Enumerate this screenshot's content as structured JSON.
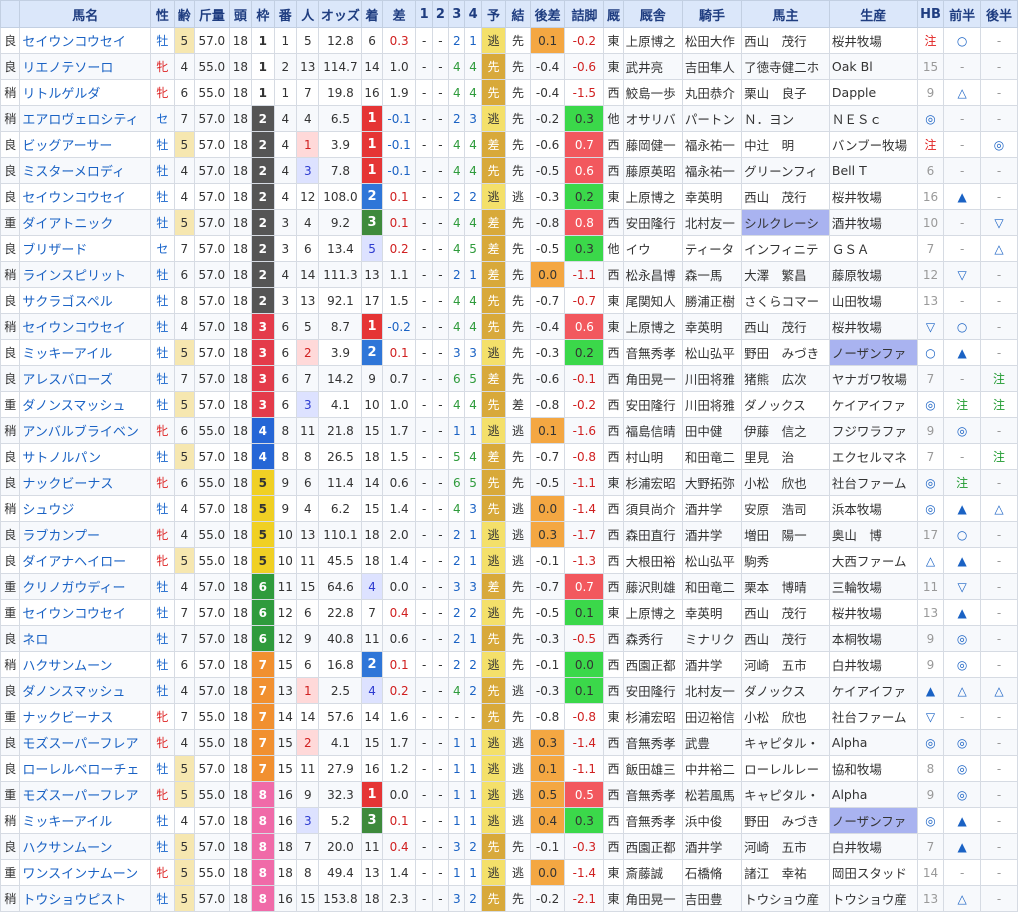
{
  "headers": [
    "馬名",
    "性",
    "齢",
    "斤量",
    "頭",
    "枠",
    "番",
    "人",
    "オッズ",
    "着",
    "差",
    "1",
    "2",
    "3",
    "4",
    "予",
    "結",
    "後差",
    "詰脚",
    "厩",
    "厩舎",
    "騎手",
    "馬主",
    "生産",
    "HB",
    "前半",
    "後半"
  ],
  "rows": [
    {
      "baba": "良",
      "name": "セイウンコウセイ",
      "sex": "牡",
      "age": "5",
      "kin": "57.0",
      "to": "18",
      "waku": "1",
      "ban": "1",
      "pop": "5",
      "odds": "12.8",
      "chaku": "6",
      "sa": "0.3",
      "c1": "-",
      "c2": "-",
      "c3": "2",
      "c4": "1",
      "yo": "逃",
      "ke": "先",
      "go": "0.1",
      "ts": "-0.2",
      "ki": "東",
      "kyu": "上原博之",
      "jk": "松田大作",
      "ow": "西山　茂行",
      "pr": "桜井牧場",
      "hb": "注",
      "mae": "○",
      "ato": "-"
    },
    {
      "baba": "良",
      "name": "リエノテソーロ",
      "sex": "牝",
      "age": "4",
      "kin": "55.0",
      "to": "18",
      "waku": "1",
      "ban": "2",
      "pop": "13",
      "odds": "114.7",
      "chaku": "14",
      "sa": "1.0",
      "c1": "-",
      "c2": "-",
      "c3": "4",
      "c4": "4",
      "yo": "先",
      "ke": "先",
      "go": "-0.4",
      "ts": "-0.6",
      "ki": "東",
      "kyu": "武井亮",
      "jk": "吉田隼人",
      "ow": "了徳寺健二ホ",
      "pr": "Oak Bl",
      "hb": "15",
      "mae": "-",
      "ato": "-"
    },
    {
      "baba": "稍",
      "name": "リトルゲルダ",
      "sex": "牝",
      "age": "6",
      "kin": "55.0",
      "to": "18",
      "waku": "1",
      "ban": "1",
      "pop": "7",
      "odds": "19.8",
      "chaku": "16",
      "sa": "1.9",
      "c1": "-",
      "c2": "-",
      "c3": "4",
      "c4": "4",
      "yo": "先",
      "ke": "先",
      "go": "-0.4",
      "ts": "-1.5",
      "ki": "西",
      "kyu": "鮫島一歩",
      "jk": "丸田恭介",
      "ow": "栗山　良子",
      "pr": "Dapple",
      "hb": "9",
      "mae": "△",
      "ato": "-"
    },
    {
      "baba": "稍",
      "name": "エアロヴェロシティ",
      "sex": "セ",
      "age": "7",
      "kin": "57.0",
      "to": "18",
      "waku": "2",
      "ban": "4",
      "pop": "4",
      "odds": "6.5",
      "chaku": "1",
      "sa": "-0.1",
      "c1": "-",
      "c2": "-",
      "c3": "2",
      "c4": "3",
      "yo": "逃",
      "ke": "先",
      "go": "-0.2",
      "ts": "0.3",
      "ki": "他",
      "kyu": "オサリバ",
      "jk": "パートン",
      "ow": "Ｎ．ヨン",
      "pr": "ＮＥＳｃ",
      "hb": "◎",
      "mae": "-",
      "ato": "-"
    },
    {
      "baba": "良",
      "name": "ビッグアーサー",
      "sex": "牡",
      "age": "5",
      "kin": "57.0",
      "to": "18",
      "waku": "2",
      "ban": "4",
      "pop": "1",
      "odds": "3.9",
      "chaku": "1",
      "sa": "-0.1",
      "c1": "-",
      "c2": "-",
      "c3": "4",
      "c4": "4",
      "yo": "差",
      "ke": "先",
      "go": "-0.6",
      "ts": "0.7",
      "ki": "西",
      "kyu": "藤岡健一",
      "jk": "福永祐一",
      "ow": "中辻　明",
      "pr": "バンブー牧場",
      "hb": "注",
      "mae": "-",
      "ato": "◎"
    },
    {
      "baba": "良",
      "name": "ミスターメロディ",
      "sex": "牡",
      "age": "4",
      "kin": "57.0",
      "to": "18",
      "waku": "2",
      "ban": "4",
      "pop": "3",
      "odds": "7.8",
      "chaku": "1",
      "sa": "-0.1",
      "c1": "-",
      "c2": "-",
      "c3": "4",
      "c4": "4",
      "yo": "先",
      "ke": "先",
      "go": "-0.5",
      "ts": "0.6",
      "ki": "西",
      "kyu": "藤原英昭",
      "jk": "福永祐一",
      "ow": "グリーンフィ",
      "pr": "Bell T",
      "hb": "6",
      "mae": "-",
      "ato": "-"
    },
    {
      "baba": "良",
      "name": "セイウンコウセイ",
      "sex": "牡",
      "age": "4",
      "kin": "57.0",
      "to": "18",
      "waku": "2",
      "ban": "4",
      "pop": "12",
      "odds": "108.0",
      "chaku": "2",
      "sa": "0.1",
      "c1": "-",
      "c2": "-",
      "c3": "2",
      "c4": "2",
      "yo": "逃",
      "ke": "逃",
      "go": "-0.3",
      "ts": "0.2",
      "ki": "東",
      "kyu": "上原博之",
      "jk": "幸英明",
      "ow": "西山　茂行",
      "pr": "桜井牧場",
      "hb": "16",
      "mae": "▲",
      "ato": "-"
    },
    {
      "baba": "重",
      "name": "ダイアトニック",
      "sex": "牡",
      "age": "5",
      "kin": "57.0",
      "to": "18",
      "waku": "2",
      "ban": "3",
      "pop": "4",
      "odds": "9.2",
      "chaku": "3",
      "sa": "0.1",
      "c1": "-",
      "c2": "-",
      "c3": "4",
      "c4": "4",
      "yo": "差",
      "ke": "先",
      "go": "-0.8",
      "ts": "0.8",
      "ki": "西",
      "kyu": "安田隆行",
      "jk": "北村友一",
      "ow": "シルクレーシ",
      "pr": "酒井牧場",
      "hb": "10",
      "mae": "-",
      "ato": "▽"
    },
    {
      "baba": "良",
      "name": "ブリザード",
      "sex": "セ",
      "age": "7",
      "kin": "57.0",
      "to": "18",
      "waku": "2",
      "ban": "3",
      "pop": "6",
      "odds": "13.4",
      "chaku": "5",
      "sa": "0.2",
      "c1": "-",
      "c2": "-",
      "c3": "4",
      "c4": "5",
      "yo": "差",
      "ke": "先",
      "go": "-0.5",
      "ts": "0.3",
      "ki": "他",
      "kyu": "イウ",
      "jk": "ティータ",
      "ow": "インフィニテ",
      "pr": "ＧＳＡ",
      "hb": "7",
      "mae": "-",
      "ato": "△"
    },
    {
      "baba": "稍",
      "name": "ラインスピリット",
      "sex": "牡",
      "age": "6",
      "kin": "57.0",
      "to": "18",
      "waku": "2",
      "ban": "4",
      "pop": "14",
      "odds": "111.3",
      "chaku": "13",
      "sa": "1.1",
      "c1": "-",
      "c2": "-",
      "c3": "2",
      "c4": "1",
      "yo": "差",
      "ke": "先",
      "go": "0.0",
      "ts": "-1.1",
      "ki": "西",
      "kyu": "松永昌博",
      "jk": "森一馬",
      "ow": "大澤　繁昌",
      "pr": "藤原牧場",
      "hb": "12",
      "mae": "▽",
      "ato": "-"
    },
    {
      "baba": "良",
      "name": "サクラゴスペル",
      "sex": "牡",
      "age": "8",
      "kin": "57.0",
      "to": "18",
      "waku": "2",
      "ban": "3",
      "pop": "13",
      "odds": "92.1",
      "chaku": "17",
      "sa": "1.5",
      "c1": "-",
      "c2": "-",
      "c3": "4",
      "c4": "4",
      "yo": "先",
      "ke": "先",
      "go": "-0.7",
      "ts": "-0.7",
      "ki": "東",
      "kyu": "尾関知人",
      "jk": "勝浦正樹",
      "ow": "さくらコマー",
      "pr": "山田牧場",
      "hb": "13",
      "mae": "-",
      "ato": "-"
    },
    {
      "baba": "稍",
      "name": "セイウンコウセイ",
      "sex": "牡",
      "age": "4",
      "kin": "57.0",
      "to": "18",
      "waku": "3",
      "ban": "6",
      "pop": "5",
      "odds": "8.7",
      "chaku": "1",
      "sa": "-0.2",
      "c1": "-",
      "c2": "-",
      "c3": "4",
      "c4": "4",
      "yo": "先",
      "ke": "先",
      "go": "-0.4",
      "ts": "0.6",
      "ki": "東",
      "kyu": "上原博之",
      "jk": "幸英明",
      "ow": "西山　茂行",
      "pr": "桜井牧場",
      "hb": "▽",
      "mae": "○",
      "ato": "-"
    },
    {
      "baba": "良",
      "name": "ミッキーアイル",
      "sex": "牡",
      "age": "5",
      "kin": "57.0",
      "to": "18",
      "waku": "3",
      "ban": "6",
      "pop": "2",
      "odds": "3.9",
      "chaku": "2",
      "sa": "0.1",
      "c1": "-",
      "c2": "-",
      "c3": "3",
      "c4": "3",
      "yo": "逃",
      "ke": "先",
      "go": "-0.3",
      "ts": "0.2",
      "ki": "西",
      "kyu": "音無秀孝",
      "jk": "松山弘平",
      "ow": "野田　みづき",
      "pr": "ノーザンファ",
      "hb": "○",
      "mae": "▲",
      "ato": "-"
    },
    {
      "baba": "良",
      "name": "アレスバローズ",
      "sex": "牡",
      "age": "7",
      "kin": "57.0",
      "to": "18",
      "waku": "3",
      "ban": "6",
      "pop": "7",
      "odds": "14.2",
      "chaku": "9",
      "sa": "0.7",
      "c1": "-",
      "c2": "-",
      "c3": "6",
      "c4": "5",
      "yo": "差",
      "ke": "先",
      "go": "-0.6",
      "ts": "-0.1",
      "ki": "西",
      "kyu": "角田晃一",
      "jk": "川田将雅",
      "ow": "猪熊　広次",
      "pr": "ヤナガワ牧場",
      "hb": "7",
      "mae": "-",
      "ato": "注"
    },
    {
      "baba": "重",
      "name": "ダノンスマッシュ",
      "sex": "牡",
      "age": "5",
      "kin": "57.0",
      "to": "18",
      "waku": "3",
      "ban": "6",
      "pop": "3",
      "odds": "4.1",
      "chaku": "10",
      "sa": "1.0",
      "c1": "-",
      "c2": "-",
      "c3": "4",
      "c4": "4",
      "yo": "先",
      "ke": "差",
      "go": "-0.8",
      "ts": "-0.2",
      "ki": "西",
      "kyu": "安田隆行",
      "jk": "川田将雅",
      "ow": "ダノックス",
      "pr": "ケイアイファ",
      "hb": "◎",
      "mae": "注",
      "ato": "注"
    },
    {
      "baba": "稍",
      "name": "アンバルブライベン",
      "sex": "牝",
      "age": "6",
      "kin": "55.0",
      "to": "18",
      "waku": "4",
      "ban": "8",
      "pop": "11",
      "odds": "21.8",
      "chaku": "15",
      "sa": "1.7",
      "c1": "-",
      "c2": "-",
      "c3": "1",
      "c4": "1",
      "yo": "逃",
      "ke": "逃",
      "go": "0.1",
      "ts": "-1.6",
      "ki": "西",
      "kyu": "福島信晴",
      "jk": "田中健",
      "ow": "伊藤　信之",
      "pr": "フジワラファ",
      "hb": "9",
      "mae": "◎",
      "ato": "-"
    },
    {
      "baba": "良",
      "name": "サトノルパン",
      "sex": "牡",
      "age": "5",
      "kin": "57.0",
      "to": "18",
      "waku": "4",
      "ban": "8",
      "pop": "8",
      "odds": "26.5",
      "chaku": "18",
      "sa": "1.5",
      "c1": "-",
      "c2": "-",
      "c3": "5",
      "c4": "4",
      "yo": "差",
      "ke": "先",
      "go": "-0.7",
      "ts": "-0.8",
      "ki": "西",
      "kyu": "村山明",
      "jk": "和田竜二",
      "ow": "里見　治",
      "pr": "エクセルマネ",
      "hb": "7",
      "mae": "-",
      "ato": "注"
    },
    {
      "baba": "良",
      "name": "ナックビーナス",
      "sex": "牝",
      "age": "6",
      "kin": "55.0",
      "to": "18",
      "waku": "5",
      "ban": "9",
      "pop": "6",
      "odds": "11.4",
      "chaku": "14",
      "sa": "0.6",
      "c1": "-",
      "c2": "-",
      "c3": "6",
      "c4": "5",
      "yo": "先",
      "ke": "先",
      "go": "-0.5",
      "ts": "-1.1",
      "ki": "東",
      "kyu": "杉浦宏昭",
      "jk": "大野拓弥",
      "ow": "小松　欣也",
      "pr": "社台ファーム",
      "hb": "◎",
      "mae": "注",
      "ato": "-"
    },
    {
      "baba": "稍",
      "name": "シュウジ",
      "sex": "牡",
      "age": "4",
      "kin": "57.0",
      "to": "18",
      "waku": "5",
      "ban": "9",
      "pop": "4",
      "odds": "6.2",
      "chaku": "15",
      "sa": "1.4",
      "c1": "-",
      "c2": "-",
      "c3": "4",
      "c4": "3",
      "yo": "先",
      "ke": "逃",
      "go": "0.0",
      "ts": "-1.4",
      "ki": "西",
      "kyu": "須貝尚介",
      "jk": "酒井学",
      "ow": "安原　浩司",
      "pr": "浜本牧場",
      "hb": "◎",
      "mae": "▲",
      "ato": "△"
    },
    {
      "baba": "良",
      "name": "ラブカンプー",
      "sex": "牝",
      "age": "4",
      "kin": "55.0",
      "to": "18",
      "waku": "5",
      "ban": "10",
      "pop": "13",
      "odds": "110.1",
      "chaku": "18",
      "sa": "2.0",
      "c1": "-",
      "c2": "-",
      "c3": "2",
      "c4": "1",
      "yo": "逃",
      "ke": "逃",
      "go": "0.3",
      "ts": "-1.7",
      "ki": "西",
      "kyu": "森田直行",
      "jk": "酒井学",
      "ow": "増田　陽一",
      "pr": "奥山　博",
      "hb": "17",
      "mae": "○",
      "ato": "-"
    },
    {
      "baba": "良",
      "name": "ダイアナヘイロー",
      "sex": "牝",
      "age": "5",
      "kin": "55.0",
      "to": "18",
      "waku": "5",
      "ban": "10",
      "pop": "11",
      "odds": "45.5",
      "chaku": "18",
      "sa": "1.4",
      "c1": "-",
      "c2": "-",
      "c3": "2",
      "c4": "1",
      "yo": "逃",
      "ke": "逃",
      "go": "-0.1",
      "ts": "-1.3",
      "ki": "西",
      "kyu": "大根田裕",
      "jk": "松山弘平",
      "ow": "駒秀",
      "pr": "大西ファーム",
      "hb": "△",
      "mae": "▲",
      "ato": "-"
    },
    {
      "baba": "重",
      "name": "クリノガウディー",
      "sex": "牡",
      "age": "4",
      "kin": "57.0",
      "to": "18",
      "waku": "6",
      "ban": "11",
      "pop": "15",
      "odds": "64.6",
      "chaku": "4",
      "sa": "0.0",
      "c1": "-",
      "c2": "-",
      "c3": "3",
      "c4": "3",
      "yo": "差",
      "ke": "先",
      "go": "-0.7",
      "ts": "0.7",
      "ki": "西",
      "kyu": "藤沢則雄",
      "jk": "和田竜二",
      "ow": "栗本　博晴",
      "pr": "三輪牧場",
      "hb": "11",
      "mae": "▽",
      "ato": "-"
    },
    {
      "baba": "重",
      "name": "セイウンコウセイ",
      "sex": "牡",
      "age": "7",
      "kin": "57.0",
      "to": "18",
      "waku": "6",
      "ban": "12",
      "pop": "6",
      "odds": "22.8",
      "chaku": "7",
      "sa": "0.4",
      "c1": "-",
      "c2": "-",
      "c3": "2",
      "c4": "2",
      "yo": "逃",
      "ke": "先",
      "go": "-0.5",
      "ts": "0.1",
      "ki": "東",
      "kyu": "上原博之",
      "jk": "幸英明",
      "ow": "西山　茂行",
      "pr": "桜井牧場",
      "hb": "13",
      "mae": "▲",
      "ato": "-"
    },
    {
      "baba": "良",
      "name": "ネロ",
      "sex": "牡",
      "age": "7",
      "kin": "57.0",
      "to": "18",
      "waku": "6",
      "ban": "12",
      "pop": "9",
      "odds": "40.8",
      "chaku": "11",
      "sa": "0.6",
      "c1": "-",
      "c2": "-",
      "c3": "2",
      "c4": "1",
      "yo": "先",
      "ke": "先",
      "go": "-0.3",
      "ts": "-0.5",
      "ki": "西",
      "kyu": "森秀行",
      "jk": "ミナリク",
      "ow": "西山　茂行",
      "pr": "本桐牧場",
      "hb": "9",
      "mae": "◎",
      "ato": "-"
    },
    {
      "baba": "稍",
      "name": "ハクサンムーン",
      "sex": "牡",
      "age": "6",
      "kin": "57.0",
      "to": "18",
      "waku": "7",
      "ban": "15",
      "pop": "6",
      "odds": "16.8",
      "chaku": "2",
      "sa": "0.1",
      "c1": "-",
      "c2": "-",
      "c3": "2",
      "c4": "2",
      "yo": "逃",
      "ke": "先",
      "go": "-0.1",
      "ts": "0.0",
      "ki": "西",
      "kyu": "西園正都",
      "jk": "酒井学",
      "ow": "河崎　五市",
      "pr": "白井牧場",
      "hb": "9",
      "mae": "◎",
      "ato": "-"
    },
    {
      "baba": "良",
      "name": "ダノンスマッシュ",
      "sex": "牡",
      "age": "4",
      "kin": "57.0",
      "to": "18",
      "waku": "7",
      "ban": "13",
      "pop": "1",
      "odds": "2.5",
      "chaku": "4",
      "sa": "0.2",
      "c1": "-",
      "c2": "-",
      "c3": "4",
      "c4": "2",
      "yo": "先",
      "ke": "逃",
      "go": "-0.3",
      "ts": "0.1",
      "ki": "西",
      "kyu": "安田隆行",
      "jk": "北村友一",
      "ow": "ダノックス",
      "pr": "ケイアイファ",
      "hb": "▲",
      "mae": "△",
      "ato": "△"
    },
    {
      "baba": "重",
      "name": "ナックビーナス",
      "sex": "牝",
      "age": "7",
      "kin": "55.0",
      "to": "18",
      "waku": "7",
      "ban": "14",
      "pop": "14",
      "odds": "57.6",
      "chaku": "14",
      "sa": "1.6",
      "c1": "-",
      "c2": "-",
      "c3": "-",
      "c4": "-",
      "yo": "先",
      "ke": "先",
      "go": "-0.8",
      "ts": "-0.8",
      "ki": "東",
      "kyu": "杉浦宏昭",
      "jk": "田辺裕信",
      "ow": "小松　欣也",
      "pr": "社台ファーム",
      "hb": "▽",
      "mae": "-",
      "ato": "-"
    },
    {
      "baba": "良",
      "name": "モズスーパーフレア",
      "sex": "牝",
      "age": "4",
      "kin": "55.0",
      "to": "18",
      "waku": "7",
      "ban": "15",
      "pop": "2",
      "odds": "4.1",
      "chaku": "15",
      "sa": "1.7",
      "c1": "-",
      "c2": "-",
      "c3": "1",
      "c4": "1",
      "yo": "逃",
      "ke": "逃",
      "go": "0.3",
      "ts": "-1.4",
      "ki": "西",
      "kyu": "音無秀孝",
      "jk": "武豊",
      "ow": "キャピタル・",
      "pr": "Alpha",
      "hb": "◎",
      "mae": "◎",
      "ato": "-"
    },
    {
      "baba": "良",
      "name": "ローレルベローチェ",
      "sex": "牡",
      "age": "5",
      "kin": "57.0",
      "to": "18",
      "waku": "7",
      "ban": "15",
      "pop": "11",
      "odds": "27.9",
      "chaku": "16",
      "sa": "1.2",
      "c1": "-",
      "c2": "-",
      "c3": "1",
      "c4": "1",
      "yo": "逃",
      "ke": "逃",
      "go": "0.1",
      "ts": "-1.1",
      "ki": "西",
      "kyu": "飯田雄三",
      "jk": "中井裕二",
      "ow": "ローレルレー",
      "pr": "協和牧場",
      "hb": "8",
      "mae": "◎",
      "ato": "-"
    },
    {
      "baba": "重",
      "name": "モズスーパーフレア",
      "sex": "牝",
      "age": "5",
      "kin": "55.0",
      "to": "18",
      "waku": "8",
      "ban": "16",
      "pop": "9",
      "odds": "32.3",
      "chaku": "1",
      "sa": "0.0",
      "c1": "-",
      "c2": "-",
      "c3": "1",
      "c4": "1",
      "yo": "逃",
      "ke": "逃",
      "go": "0.5",
      "ts": "0.5",
      "ki": "西",
      "kyu": "音無秀孝",
      "jk": "松若風馬",
      "ow": "キャピタル・",
      "pr": "Alpha",
      "hb": "9",
      "mae": "◎",
      "ato": "-"
    },
    {
      "baba": "稍",
      "name": "ミッキーアイル",
      "sex": "牡",
      "age": "4",
      "kin": "57.0",
      "to": "18",
      "waku": "8",
      "ban": "16",
      "pop": "3",
      "odds": "5.2",
      "chaku": "3",
      "sa": "0.1",
      "c1": "-",
      "c2": "-",
      "c3": "1",
      "c4": "1",
      "yo": "逃",
      "ke": "逃",
      "go": "0.4",
      "ts": "0.3",
      "ki": "西",
      "kyu": "音無秀孝",
      "jk": "浜中俊",
      "ow": "野田　みづき",
      "pr": "ノーザンファ",
      "hb": "◎",
      "mae": "▲",
      "ato": "-"
    },
    {
      "baba": "良",
      "name": "ハクサンムーン",
      "sex": "牡",
      "age": "5",
      "kin": "57.0",
      "to": "18",
      "waku": "8",
      "ban": "18",
      "pop": "7",
      "odds": "20.0",
      "chaku": "11",
      "sa": "0.4",
      "c1": "-",
      "c2": "-",
      "c3": "3",
      "c4": "2",
      "yo": "先",
      "ke": "先",
      "go": "-0.1",
      "ts": "-0.3",
      "ki": "西",
      "kyu": "西園正都",
      "jk": "酒井学",
      "ow": "河崎　五市",
      "pr": "白井牧場",
      "hb": "7",
      "mae": "▲",
      "ato": "-"
    },
    {
      "baba": "重",
      "name": "ワンスインナムーン",
      "sex": "牝",
      "age": "5",
      "kin": "55.0",
      "to": "18",
      "waku": "8",
      "ban": "18",
      "pop": "8",
      "odds": "49.4",
      "chaku": "13",
      "sa": "1.4",
      "c1": "-",
      "c2": "-",
      "c3": "1",
      "c4": "1",
      "yo": "逃",
      "ke": "逃",
      "go": "0.0",
      "ts": "-1.4",
      "ki": "東",
      "kyu": "斎藤誠",
      "jk": "石橋脩",
      "ow": "諸江　幸祐",
      "pr": "岡田スタッド",
      "hb": "14",
      "mae": "-",
      "ato": "-"
    },
    {
      "baba": "稍",
      "name": "トウショウピスト",
      "sex": "牡",
      "age": "5",
      "kin": "57.0",
      "to": "18",
      "waku": "8",
      "ban": "16",
      "pop": "15",
      "odds": "153.8",
      "chaku": "18",
      "sa": "2.3",
      "c1": "-",
      "c2": "-",
      "c3": "3",
      "c4": "2",
      "yo": "先",
      "ke": "先",
      "go": "-0.2",
      "ts": "-2.1",
      "ki": "東",
      "kyu": "角田晃一",
      "jk": "吉田豊",
      "ow": "トウショウ産",
      "pr": "トウショウ産",
      "hb": "13",
      "mae": "△",
      "ato": "-"
    }
  ],
  "colors": {
    "header_bg": "#dbe7fa",
    "name_link": "#1a62c4",
    "red": "#dd2222",
    "blue": "#1a66cc"
  }
}
